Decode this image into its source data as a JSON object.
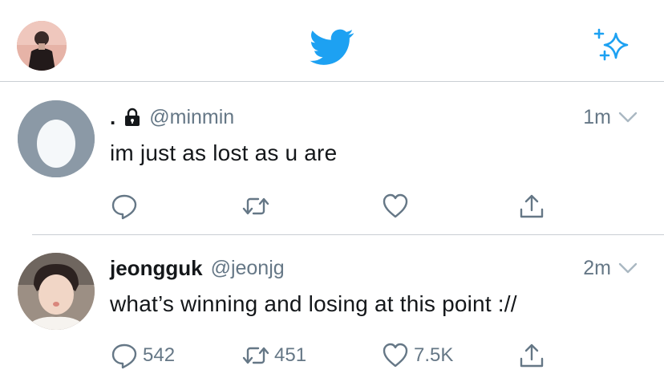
{
  "header": {
    "profile_icon": "profile-avatar",
    "logo_icon": "twitter-bird-icon",
    "sparkle_icon": "sparkle-icon",
    "colors": {
      "brand": "#1da1f2"
    }
  },
  "tweets": [
    {
      "name": ".",
      "protected": true,
      "handle": "@minmin",
      "time": "1m",
      "text": "im just as lost as u are",
      "reply_count": "",
      "retweet_count": "",
      "like_count": ""
    },
    {
      "name": "jeongguk",
      "protected": false,
      "handle": "@jeonjg",
      "time": "2m",
      "text": "what’s winning and losing at this point ://",
      "reply_count": "542",
      "retweet_count": "451",
      "like_count": "7.5K"
    }
  ]
}
